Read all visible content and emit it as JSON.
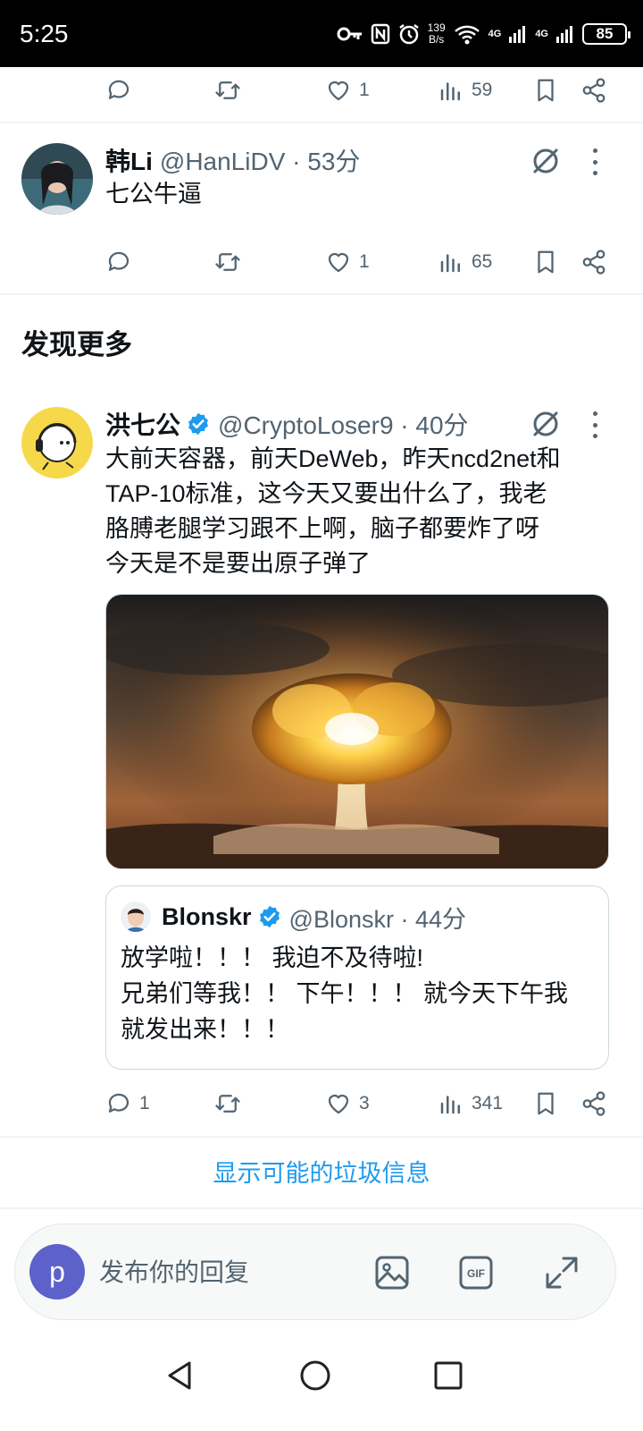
{
  "status_bar": {
    "time": "5:25",
    "net_speed_value": "139",
    "net_speed_unit": "B/s",
    "wifi_label": "6",
    "sim1": "4G",
    "sim2": "4G",
    "battery": "85"
  },
  "top_tweet_actions": {
    "likes": "1",
    "views": "59"
  },
  "tweet1": {
    "name": "韩Li",
    "handle": "@HanLiDV · 53分",
    "text": "七公牛逼",
    "actions": {
      "likes": "1",
      "views": "65"
    }
  },
  "section_title": "发现更多",
  "tweet2": {
    "name": "洪七公",
    "handle": "@CryptoLoser9 · 40分",
    "text_lines": [
      "大前天容器，前天DeWeb，昨天ncd2net和",
      "TAP-10标准，这今天又要出什么了，我老",
      "胳膊老腿学习跟不上啊，脑子都要炸了呀",
      "今天是不是要出原子弹了"
    ],
    "quote": {
      "name": "Blonskr",
      "handle": "@Blonskr · 44分",
      "text_lines": [
        "放学啦！！！ 我迫不及待啦!",
        "兄弟们等我！！ 下午！！！ 就今天下午我",
        "就发出来！！！"
      ]
    },
    "actions": {
      "replies": "1",
      "likes": "3",
      "views": "341"
    }
  },
  "spam_link": "显示可能的垃圾信息",
  "composer": {
    "avatar_letter": "p",
    "placeholder": "发布你的回复"
  },
  "colors": {
    "accent": "#1d9bf0",
    "muted": "#536471",
    "avatar_bg": "#5c62c9"
  }
}
